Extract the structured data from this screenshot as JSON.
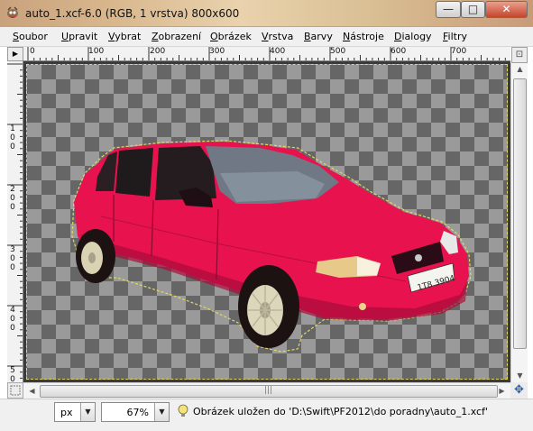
{
  "window": {
    "title": "auto_1.xcf-6.0 (RGB, 1 vrstva) 800x600",
    "minimize_glyph": "—",
    "maximize_glyph": "□",
    "close_glyph": "✕"
  },
  "menu": {
    "items": [
      "Soubor",
      "Upravit",
      "Vybrat",
      "Zobrazení",
      "Obrázek",
      "Vrstva",
      "Barvy",
      "Nástroje",
      "Dialogy",
      "Filtry"
    ]
  },
  "ruler": {
    "horizontal": [
      "0",
      "100",
      "200",
      "300",
      "400",
      "500",
      "600",
      "700"
    ],
    "vertical": [
      "1",
      "0",
      "0",
      "2",
      "0",
      "0",
      "3",
      "0",
      "0",
      "4",
      "0",
      "0",
      "5",
      "0"
    ]
  },
  "statusbar": {
    "unit": "px",
    "zoom": "67%",
    "message": "Obrázek uložen do 'D:\\Swift\\PF2012\\do poradny\\auto_1.xcf'"
  },
  "icons": {
    "app": "gimp-icon",
    "navigate": "navigate-icon",
    "status": "lightbulb-icon"
  },
  "colors": {
    "car_body": "#e8124f",
    "selection_outline": "#e5d85c",
    "canvas_checker_dark": "#666666",
    "canvas_checker_light": "#9a9a9a"
  }
}
